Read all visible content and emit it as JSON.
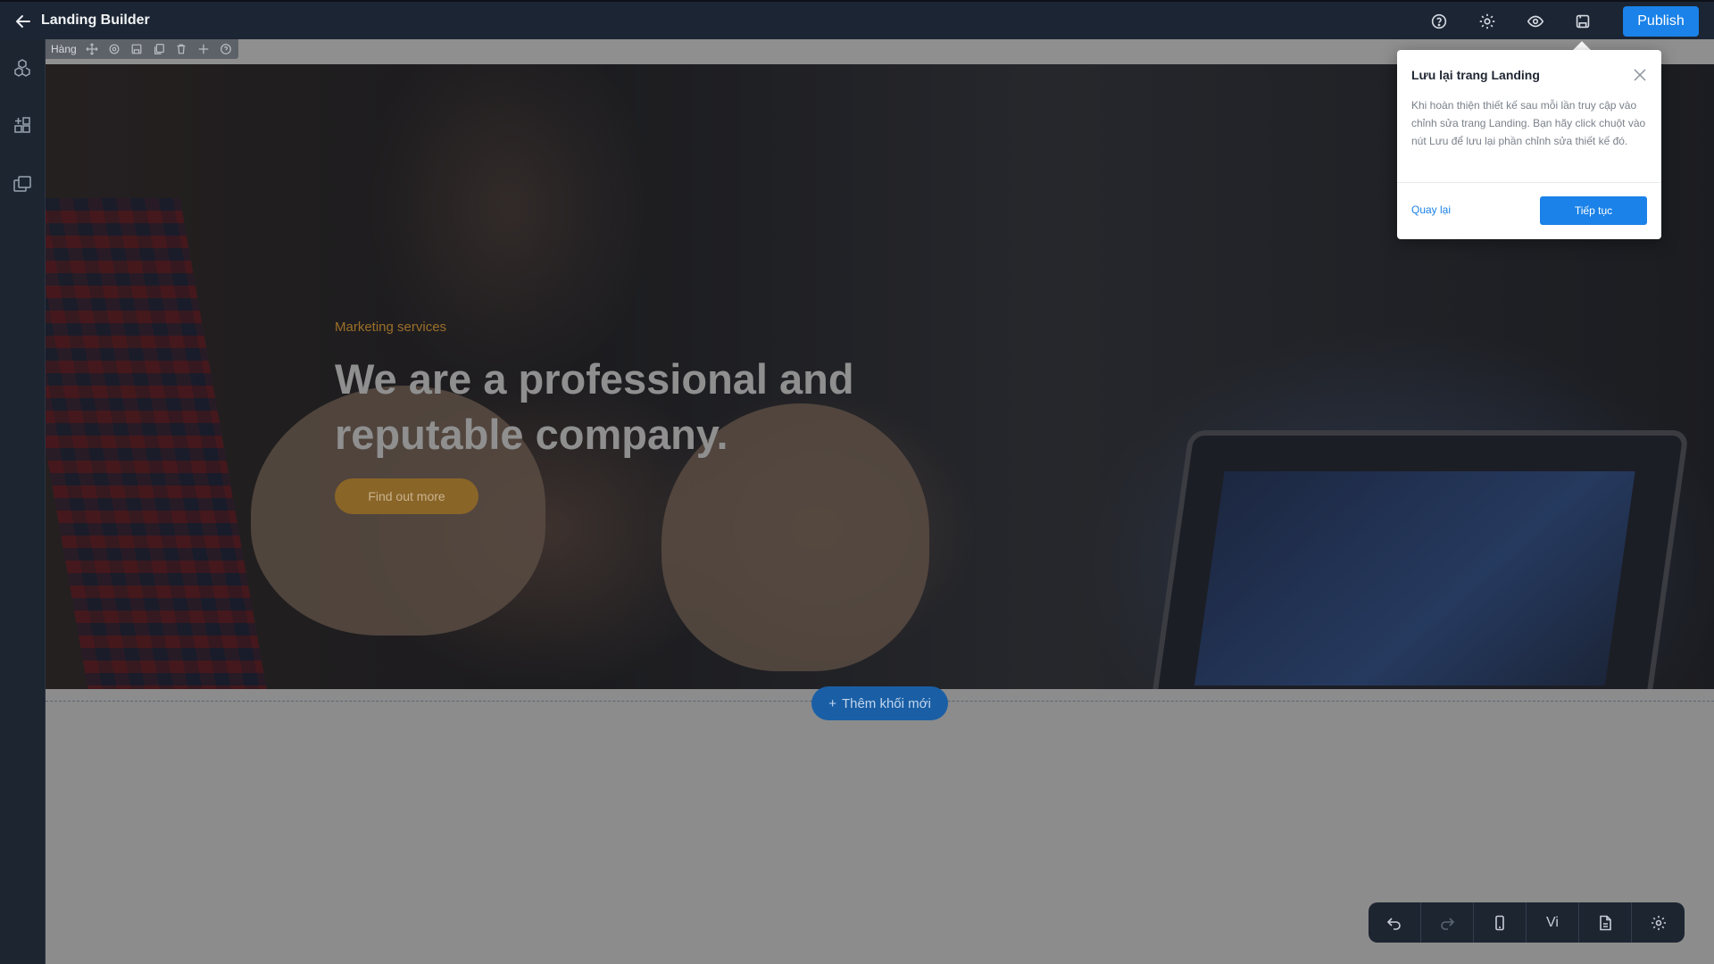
{
  "topbar": {
    "title": "Landing Builder",
    "publish_label": "Publish",
    "icons": [
      "back-arrow-icon",
      "help-icon",
      "settings-icon",
      "preview-eye-icon",
      "save-icon"
    ]
  },
  "sidebar": {
    "icons": [
      "components-icon",
      "add-block-icon",
      "pages-icon"
    ]
  },
  "row_toolbar": {
    "label": "Hàng",
    "icons": [
      "move-icon",
      "settings-icon",
      "save-icon",
      "duplicate-icon",
      "delete-icon",
      "add-icon",
      "help-icon"
    ]
  },
  "hero": {
    "tag": "Marketing services",
    "title": "We are a professional and reputable company.",
    "button": "Find out more"
  },
  "add_block_label": "Thêm khối mới",
  "popover": {
    "title": "Lưu lại trang Landing",
    "body": "Khi hoàn thiện thiết kế sau mỗi lần truy cập vào chỉnh sửa trang Landing. Bạn hãy click chuột vào nút Lưu để lưu lại phần chỉnh sửa thiết kế đó.",
    "back_label": "Quay lại",
    "next_label": "Tiếp tục"
  },
  "bottom_toolbar": {
    "language_label": "Vi",
    "icons": [
      "undo-icon",
      "redo-icon",
      "mobile-view-icon",
      "language-toggle",
      "page-icon",
      "settings-icon"
    ]
  },
  "colors": {
    "accent": "#1a82e8",
    "topbar_bg": "#1c2533",
    "hero_tag": "#9b6f2a",
    "hero_button": "#8a6528"
  }
}
